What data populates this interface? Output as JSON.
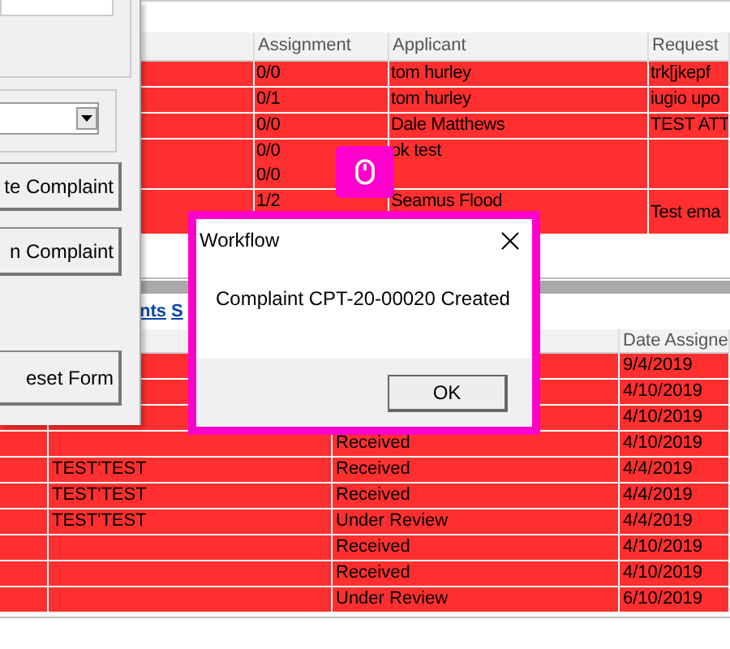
{
  "main_grid": {
    "columns": [
      "Assignment",
      "Applicant",
      "Request"
    ],
    "rows": [
      {
        "assignment": [
          "0/0"
        ],
        "applicant": "tom hurley",
        "request": "trk[jkepf"
      },
      {
        "assignment": [
          "0/1"
        ],
        "applicant": "tom hurley",
        "request": "iugio upo"
      },
      {
        "assignment": [
          "0/0"
        ],
        "applicant": "Dale Matthews",
        "request": "TEST ATT"
      },
      {
        "assignment": [
          "0/0",
          "0/0"
        ],
        "applicant": "ok test"
      },
      {
        "assignment": [
          "1/2"
        ],
        "applicant": "Seamus Flood",
        "request": "Test ema"
      }
    ]
  },
  "links": [
    "nts",
    "S"
  ],
  "bottom_grid": {
    "date_column": "Date Assigne",
    "rows": [
      {
        "date": "9/4/2019"
      },
      {
        "date": "4/10/2019"
      },
      {
        "date": "4/10/2019"
      },
      {
        "status": "Received",
        "date": "4/10/2019"
      },
      {
        "name": "TEST'TEST",
        "status": "Received",
        "date": "4/4/2019"
      },
      {
        "name": "TEST'TEST",
        "status": "Received",
        "date": "4/4/2019"
      },
      {
        "name": "TEST'TEST",
        "status": "Under Review",
        "date": "4/4/2019"
      },
      {
        "status": "Received",
        "date": "4/10/2019"
      },
      {
        "status": "Received",
        "date": "4/10/2019"
      },
      {
        "status": "Under Review",
        "date": "6/10/2019"
      }
    ]
  },
  "form_panel": {
    "buttons": [
      "te Complaint",
      "n Complaint",
      "eset Form"
    ]
  },
  "dialog": {
    "title": "Workflow",
    "message": "Complaint CPT-20-00020 Created",
    "button": "OK"
  }
}
